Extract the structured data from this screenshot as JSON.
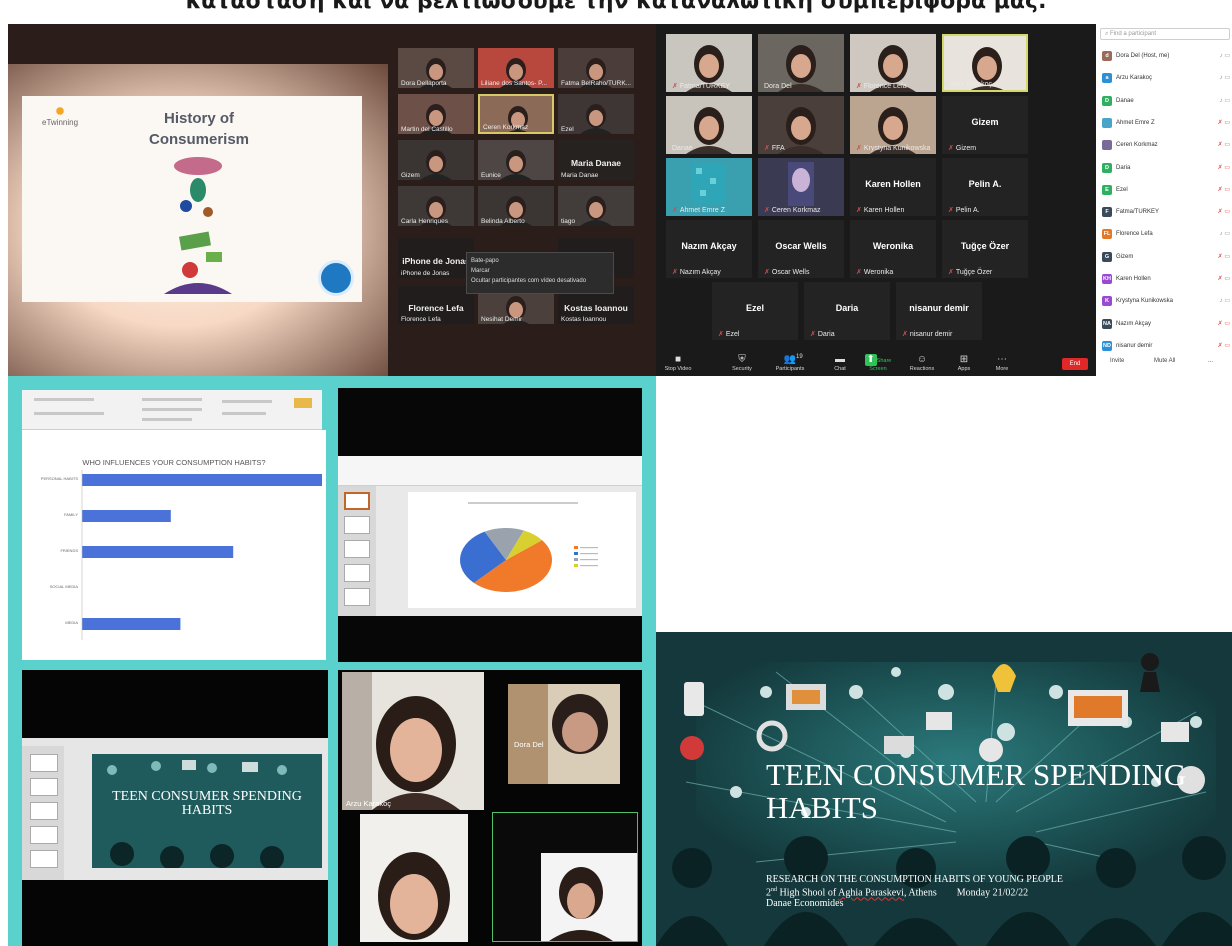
{
  "caption": "κατάσταση και να βελτιώσουμε την καταναλωτική συμπεριφορά μας.",
  "meeting_photo": {
    "slide": {
      "title": "History of Consumerism",
      "logo_text": "eTwinning"
    },
    "tiles": [
      {
        "name": "Dora Dellaporta"
      },
      {
        "name": "Liliane dos Santos- P..."
      },
      {
        "name": "Fatma BelRaho/TURK..."
      },
      {
        "name": "Martin del Castillo"
      },
      {
        "name": "Ceren Korkmaz"
      },
      {
        "name": "Ezel"
      },
      {
        "name": "Gizem"
      },
      {
        "name": "Eunice"
      },
      {
        "name": "Maria Danae",
        "big": "Maria Danae"
      },
      {
        "name": "Carla Henriques"
      },
      {
        "name": "Belinda Alberto"
      },
      {
        "name": "tiago"
      },
      {
        "name": "iPhone de Jonas",
        "big": "iPhone de Jonas"
      },
      {
        "name": "",
        "big": "zer"
      },
      {
        "name": "Florence Lefa",
        "big": "Florence Lefa"
      },
      {
        "name": "Nesihat Demir"
      },
      {
        "name": "Kostas Ioannou",
        "big": "Kostas Ioannou"
      }
    ],
    "context_menu": [
      "Bate-papo",
      "Marcar",
      "Ocultar participantes com vídeo desativado"
    ]
  },
  "zoom": {
    "tiles": [
      {
        "name": "Fatma/TURKEY"
      },
      {
        "name": "Dora Del"
      },
      {
        "name": "Florence Lefa"
      },
      {
        "name": "Arzu Karakoç"
      },
      {
        "name": "Danae"
      },
      {
        "name": "FFA"
      },
      {
        "name": "Krystyna Kunikowska"
      },
      {
        "name": "Gizem",
        "big": "Gizem"
      },
      {
        "name": "Ahmet Emre Z"
      },
      {
        "name": "Ceren Korkmaz"
      },
      {
        "name": "Karen Hollen",
        "big": "Karen Hollen"
      },
      {
        "name": "Pelin A.",
        "big": "Pelin A."
      },
      {
        "name": "Nazım Akçay",
        "big": "Nazım Akçay"
      },
      {
        "name": "Oscar Wells",
        "big": "Oscar Wells"
      },
      {
        "name": "Weronika",
        "big": "Weronika"
      },
      {
        "name": "Tuğçe Özer",
        "big": "Tuğçe Özer"
      },
      {
        "name": "Ezel",
        "big": "Ezel"
      },
      {
        "name": "Daria",
        "big": "Daria"
      },
      {
        "name": "nisanur demir",
        "big": "nisanur demir"
      }
    ],
    "toolbar": [
      {
        "icon": "camera-icon",
        "label": "Stop Video"
      },
      {
        "icon": "shield-icon",
        "label": "Security"
      },
      {
        "icon": "participants-icon",
        "label": "Participants",
        "count": "19"
      },
      {
        "icon": "chat-icon",
        "label": "Chat"
      },
      {
        "icon": "share-screen-icon",
        "label": "Share Screen"
      },
      {
        "icon": "reactions-icon",
        "label": "Reactions"
      },
      {
        "icon": "apps-icon",
        "label": "Apps"
      },
      {
        "icon": "more-icon",
        "label": "More"
      }
    ],
    "end_label": "End",
    "search_placeholder": "Find a participant",
    "participants": [
      {
        "initials": "d",
        "name": "Dora Del (Host, me)",
        "color": "#9b6b5a",
        "muted": false
      },
      {
        "initials": "a",
        "name": "Arzu Karakoç",
        "color": "#2d8fd6",
        "muted": false
      },
      {
        "initials": "D",
        "name": "Danae",
        "color": "#2eb060",
        "muted": false
      },
      {
        "initials": "",
        "name": "Ahmet Emre Z",
        "color": "#4aa3c8",
        "muted": true
      },
      {
        "initials": "",
        "name": "Ceren Korkmaz",
        "color": "#7a6a9a",
        "muted": true
      },
      {
        "initials": "D",
        "name": "Daria",
        "color": "#2eb060",
        "muted": true
      },
      {
        "initials": "E",
        "name": "Ezel",
        "color": "#2eb060",
        "muted": true
      },
      {
        "initials": "F",
        "name": "Fatma/TURKEY",
        "color": "#3a4a5a",
        "muted": true
      },
      {
        "initials": "FL",
        "name": "Florence Lefa",
        "color": "#e07a2a",
        "muted": false
      },
      {
        "initials": "G",
        "name": "Gizem",
        "color": "#3a4a5a",
        "muted": true
      },
      {
        "initials": "KH",
        "name": "Karen Hollen",
        "color": "#9a4ad0",
        "muted": true
      },
      {
        "initials": "K",
        "name": "Krystyna Kunikowska",
        "color": "#9a4ad0",
        "muted": false
      },
      {
        "initials": "NA",
        "name": "Nazım Akçay",
        "color": "#3a4a5a",
        "muted": true
      },
      {
        "initials": "ND",
        "name": "nisanur demir",
        "color": "#2d8fd6",
        "muted": true
      }
    ],
    "invite_label": "Invite",
    "mute_all_label": "Mute All",
    "more_label": "..."
  },
  "chart_data": [
    {
      "type": "bar",
      "title": "WHO INFLUENCES YOUR CONSUMPTION HABITS?",
      "categories": [
        "PERSONAL HABITS",
        "FAMILY",
        "FRIENDS",
        "SOCIAL MEDIA",
        "MEDIA"
      ],
      "values": [
        100,
        37,
        63,
        0,
        41
      ],
      "xlim": [
        0,
        100
      ],
      "orientation": "horizontal",
      "color": "#4a72d9"
    },
    {
      "type": "pie",
      "values": [
        48,
        30,
        14,
        8
      ],
      "colors": [
        "#f07a2a",
        "#3a6ed0",
        "#9aa3ad",
        "#d8d030"
      ]
    }
  ],
  "share_slide": {
    "title": "TEEN CONSUMER SPENDING HABITS"
  },
  "video_names": {
    "a": "Arzu Karakoç",
    "b": "Dora Del"
  },
  "title_slide": {
    "title": "TEEN CONSUMER SPENDING HABITS",
    "subtitle": "RESEARCH ON THE CONSUMPTION HABITS OF YOUNG PEOPLE",
    "school_ordinal": "2",
    "school_suffix": "nd",
    "school_rest": " High Shool of ",
    "school_place": "Aghia Paraskevi",
    "school_city": ", Athens",
    "date": "Monday 21/02/22",
    "author": "Danae Economides"
  }
}
